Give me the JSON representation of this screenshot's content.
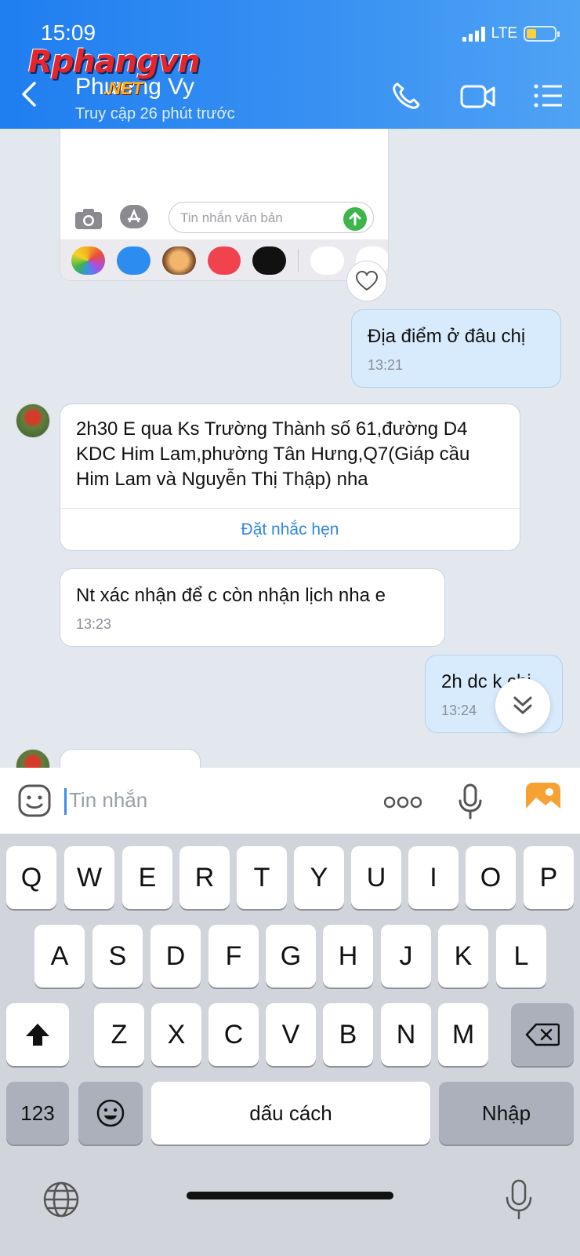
{
  "status_bar": {
    "time": "15:09",
    "network": "LTE"
  },
  "header": {
    "contact_name": "Phương Vy",
    "last_seen": "Truy cập 26 phút trước",
    "watermark_main": "Rphangvn",
    "watermark_sub": ".NET",
    "icons": [
      "back-icon",
      "phone-icon",
      "video-icon",
      "menu-icon"
    ]
  },
  "image_preview": {
    "text_field_placeholder": "Tin nhắn văn bản"
  },
  "messages": [
    {
      "direction": "out",
      "text": "Địa điểm ở đâu chị",
      "time": "13:21"
    },
    {
      "direction": "in",
      "text": "2h30 E qua Ks Trường Thành số 61,đường D4 KDC Him Lam,phường Tân Hưng,Q7(Giáp cầu Him Lam và Nguyễn Thị Thập) nha",
      "action": "Đặt nhắc hẹn"
    },
    {
      "direction": "in",
      "text": "Nt xác nhận để c còn nhận lịch nha e",
      "time": "13:23"
    },
    {
      "direction": "out",
      "text": "2h dc k chị",
      "time": "13:24"
    }
  ],
  "input": {
    "placeholder": "Tin nhắn"
  },
  "keyboard": {
    "row1": [
      "Q",
      "W",
      "E",
      "R",
      "T",
      "Y",
      "U",
      "I",
      "O",
      "P"
    ],
    "row2": [
      "A",
      "S",
      "D",
      "F",
      "G",
      "H",
      "J",
      "K",
      "L"
    ],
    "row3": [
      "Z",
      "X",
      "C",
      "V",
      "B",
      "N",
      "M"
    ],
    "numbers_key": "123",
    "space_key": "dấu cách",
    "enter_key": "Nhập"
  },
  "colors": {
    "header": "#2d86f0",
    "outgoing_bubble": "#d8ebfd",
    "link": "#2f87e6"
  }
}
